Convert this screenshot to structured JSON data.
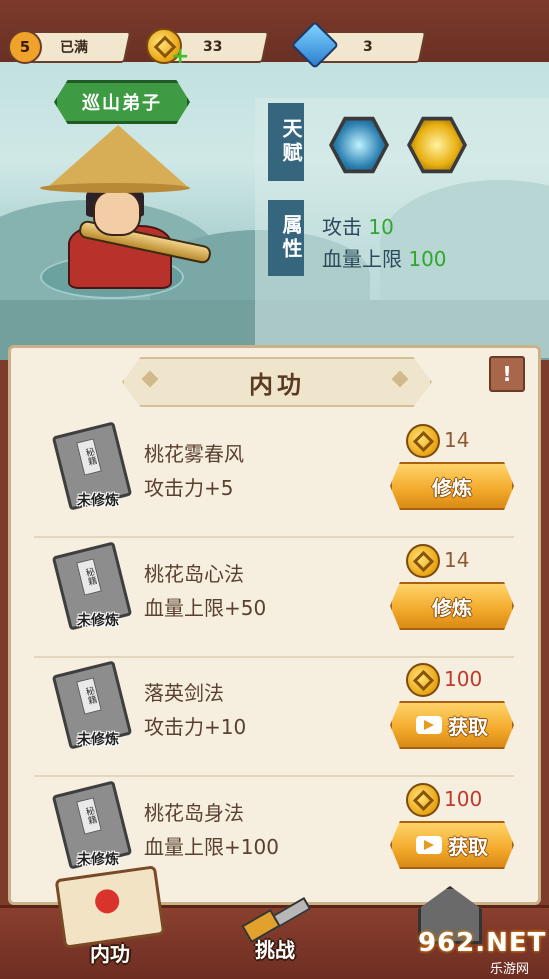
{
  "top_bar": {
    "level": "5",
    "level_status": "已满",
    "coins": "33",
    "gems": "3"
  },
  "character": {
    "rank": "巡山弟子"
  },
  "info": {
    "talent_label": "天赋",
    "attr_label": "属性",
    "skills": [
      "wind-slash-icon",
      "golden-gourd-icon"
    ],
    "attack_label": "攻击",
    "attack_value": "10",
    "hp_label": "血量上限",
    "hp_value": "100"
  },
  "panel": {
    "title": "内功",
    "info_button": "!"
  },
  "skills": [
    {
      "book_label": "秘籍",
      "status": "未修炼",
      "name": "桃花雾春风",
      "effect": "攻击力+5",
      "cost": "14",
      "action": "修炼",
      "action_type": "train"
    },
    {
      "book_label": "秘籍",
      "status": "未修炼",
      "name": "桃花岛心法",
      "effect": "血量上限+50",
      "cost": "14",
      "action": "修炼",
      "action_type": "train"
    },
    {
      "book_label": "秘籍",
      "status": "未修炼",
      "name": "落英剑法",
      "effect": "攻击力+10",
      "cost": "100",
      "action": "获取",
      "action_type": "video"
    },
    {
      "book_label": "秘籍",
      "status": "未修炼",
      "name": "桃花岛身法",
      "effect": "血量上限+100",
      "cost": "100",
      "action": "获取",
      "action_type": "video"
    }
  ],
  "nav": {
    "tab1": "内功",
    "tab2": "挑战"
  },
  "watermark": {
    "main": "962.NET",
    "sub": "乐游网"
  },
  "colors": {
    "frame": "#7b3a2b",
    "panel": "#f6efe0",
    "button": "#f2a92a",
    "green_value": "#2ea82a",
    "cost_red": "#c0392b"
  }
}
